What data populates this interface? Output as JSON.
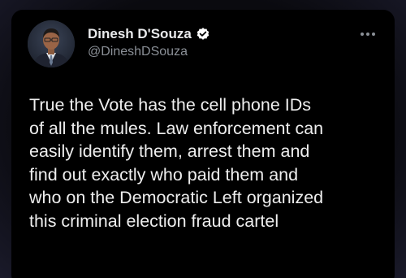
{
  "tweet": {
    "author": {
      "display_name": "Dinesh D'Souza",
      "handle": "@DineshDSouza",
      "verified": true
    },
    "text_lines": [
      "True the Vote has the cell phone IDs",
      "of all the mules. Law enforcement can",
      "easily identify them, arrest them and",
      "find out exactly who paid them and",
      "who on the Democratic Left organized",
      "this criminal election fraud cartel"
    ],
    "icons": {
      "verified": "verified-badge-icon",
      "more": "more-options-icon"
    }
  },
  "colors": {
    "background": "#000000",
    "primary_text": "#e9eaec",
    "secondary_text": "#8b9097",
    "verified_badge": "#1d9bf0"
  }
}
